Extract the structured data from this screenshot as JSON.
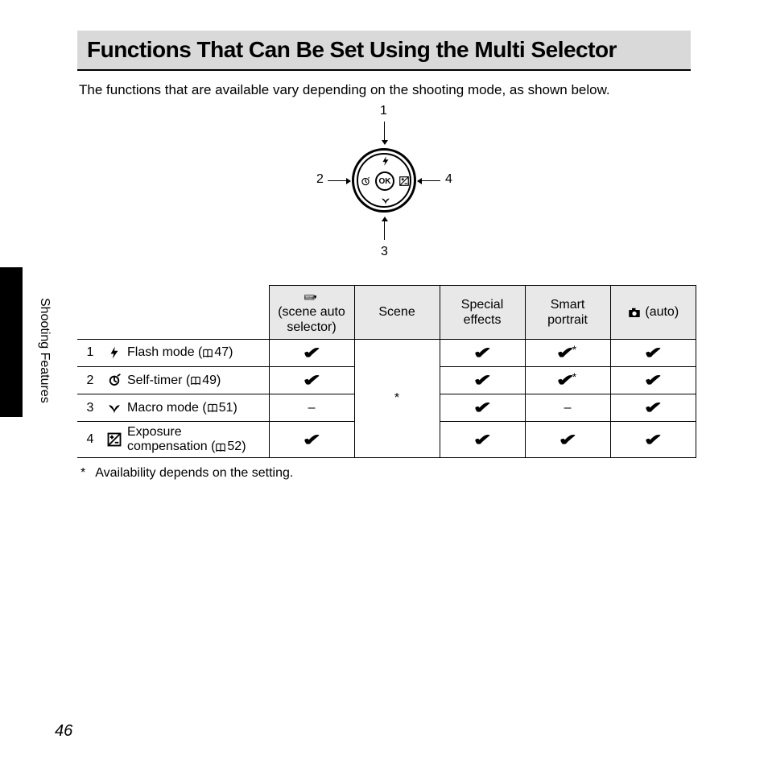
{
  "title": "Functions That Can Be Set Using the Multi Selector",
  "intro": "The functions that are available vary depending on the shooting mode, as shown below.",
  "sideLabel": "Shooting Features",
  "diagram": {
    "center": "OK",
    "labels": [
      "1",
      "2",
      "3",
      "4"
    ]
  },
  "columns": {
    "sceneAuto": {
      "line1": "(scene auto",
      "line2": "selector)"
    },
    "scene": "Scene",
    "special": "Special effects",
    "smart": "Smart portrait",
    "auto": "(auto)"
  },
  "rows": [
    {
      "n": "1",
      "name": "Flash mode (",
      "page": "47",
      "end": ")",
      "cells": [
        "check",
        "",
        "check",
        "check-ast",
        "check"
      ]
    },
    {
      "n": "2",
      "name": "Self-timer (",
      "page": "49",
      "end": ")",
      "cells": [
        "check",
        "",
        "check",
        "check-ast",
        "check"
      ]
    },
    {
      "n": "3",
      "name": "Macro mode (",
      "page": "51",
      "end": ")",
      "cells": [
        "dash",
        "",
        "check",
        "dash",
        "check"
      ]
    },
    {
      "n": "4",
      "name": "Exposure compensation (",
      "page": "52",
      "end": ")",
      "cells": [
        "check",
        "",
        "check",
        "check",
        "check"
      ]
    }
  ],
  "sceneMergedCell": "*",
  "footnote": {
    "mark": "*",
    "text": "Availability depends on the setting."
  },
  "pageNumber": "46"
}
